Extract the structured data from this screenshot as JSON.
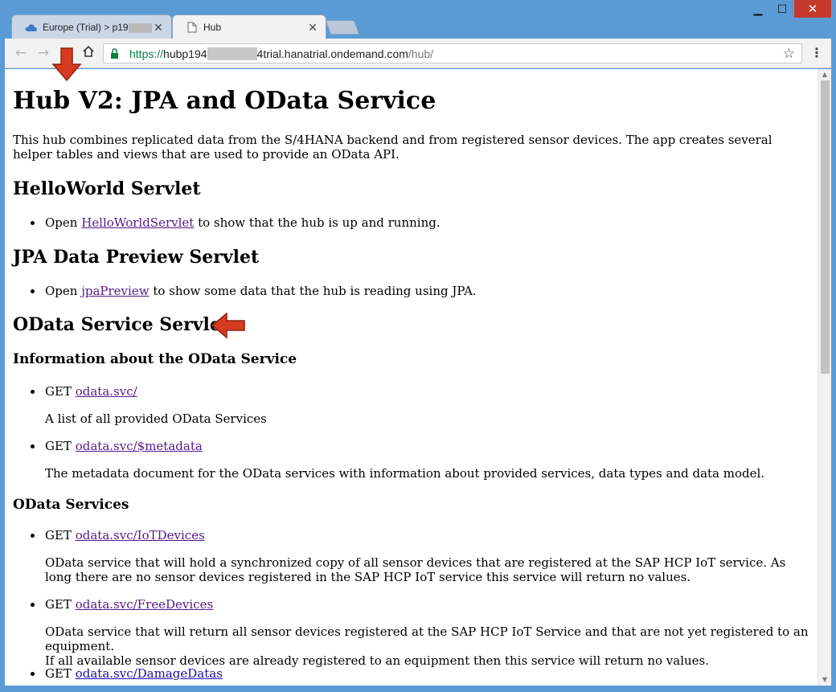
{
  "browser": {
    "tabs": [
      {
        "label": "Europe (Trial) > p19",
        "icon": "cloud-icon",
        "active": false
      },
      {
        "label": "Hub",
        "icon": "page-icon",
        "active": true
      }
    ],
    "url": {
      "scheme": "https://",
      "host_start": "hubp194",
      "host_end": "4trial.hanatrial.ondemand.com",
      "path": "/hub/"
    }
  },
  "page": {
    "title": "Hub V2: JPA and OData Service",
    "intro": "This hub combines replicated data from the S/4HANA backend and from registered sensor devices. The app creates several helper tables and views that are used to provide an OData API.",
    "helloworld": {
      "heading": "HelloWorld Servlet",
      "prefix": "Open",
      "link": "HelloWorldServlet",
      "suffix": "to show that the hub is up and running."
    },
    "jpa": {
      "heading": "JPA Data Preview Servlet",
      "prefix": "Open",
      "link": "jpaPreview",
      "suffix": "to show some data that the hub is reading using JPA."
    },
    "odata": {
      "heading": "OData Service Servlet",
      "info_heading": "Information about the OData Service",
      "info_items": [
        {
          "method": "GET",
          "link": "odata.svc/",
          "desc": "A list of all provided OData Services"
        },
        {
          "method": "GET",
          "link": "odata.svc/$metadata",
          "desc": "The metadata document for the OData services with information about provided services, data types and data model."
        }
      ],
      "services_heading": "OData Services",
      "service_items": [
        {
          "method": "GET",
          "link": "odata.svc/IoTDevices",
          "desc": "OData service that will hold a synchronized copy of all sensor devices that are registered at the SAP HCP IoT service. As long there are no sensor devices registered in the SAP HCP IoT service this service will return no values."
        },
        {
          "method": "GET",
          "link": "odata.svc/FreeDevices",
          "desc_line1": "OData service that will return all sensor devices registered at the SAP HCP IoT Service and that are not yet registered to an equipment.",
          "desc_line2": "If all available sensor devices are already registered to an equipment then this service will return no values."
        },
        {
          "method": "GET",
          "link": "odata.svc/DamageDatas"
        }
      ]
    }
  }
}
